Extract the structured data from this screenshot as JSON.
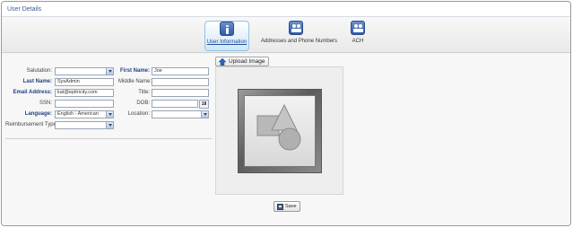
{
  "window": {
    "title": "User Details"
  },
  "tabs": [
    {
      "label": "User Information",
      "icon": "info-icon",
      "active": true
    },
    {
      "label": "Addresses and Phone Numbers",
      "icon": "contacts-icon",
      "active": false
    },
    {
      "label": "ACH",
      "icon": "ach-icon",
      "active": false
    }
  ],
  "form": {
    "salutation": {
      "label": "Salutation:",
      "value": ""
    },
    "first_name": {
      "label": "First Name:",
      "value": "Joe"
    },
    "last_name": {
      "label": "Last Name:",
      "value": "SysAdmin"
    },
    "middle_name": {
      "label": "Middle Name:",
      "value": ""
    },
    "email": {
      "label": "Email Address:",
      "value": "kat@epitricity.com"
    },
    "title": {
      "label": "Title:",
      "value": ""
    },
    "ssn": {
      "label": "SSN:",
      "value": ""
    },
    "dob": {
      "label": "DOB:",
      "value": "",
      "calendar_text": "18"
    },
    "language": {
      "label": "Language:",
      "value": "English - American"
    },
    "location": {
      "label": "Location:",
      "value": ""
    },
    "reimbursement": {
      "label": "Reimbursement Type:",
      "value": ""
    }
  },
  "image": {
    "upload_label": "Upload Image"
  },
  "actions": {
    "save_label": "Save"
  },
  "colors": {
    "accent": "#1f3f86",
    "tab_active": "#cfe6f7",
    "icon_blue": "#2f5aa6"
  }
}
